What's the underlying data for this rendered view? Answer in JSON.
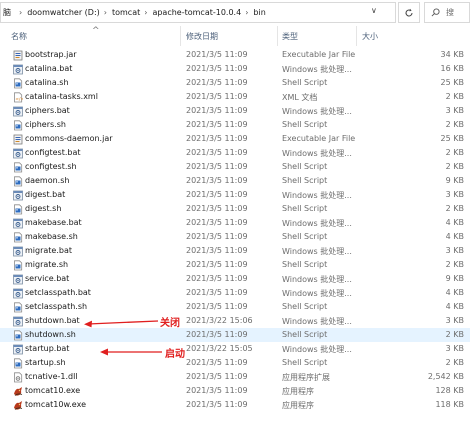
{
  "address": {
    "partial_crumb": "脑",
    "crumbs": [
      "doomwatcher (D:)",
      "tomcat",
      "apache-tomcat-10.0.4",
      "bin"
    ],
    "search_placeholder": "搜"
  },
  "columns": {
    "name": "名称",
    "date": "修改日期",
    "type": "类型",
    "size": "大小"
  },
  "files": [
    {
      "name": "bootstrap.jar",
      "date": "2021/3/5 11:09",
      "type": "Executable Jar File",
      "size": "34 KB",
      "icon": "jar-icon"
    },
    {
      "name": "catalina.bat",
      "date": "2021/3/5 11:09",
      "type": "Windows 批处理...",
      "size": "16 KB",
      "icon": "bat-icon"
    },
    {
      "name": "catalina.sh",
      "date": "2021/3/5 11:09",
      "type": "Shell Script",
      "size": "25 KB",
      "icon": "sh-icon"
    },
    {
      "name": "catalina-tasks.xml",
      "date": "2021/3/5 11:09",
      "type": "XML 文档",
      "size": "2 KB",
      "icon": "xml-icon"
    },
    {
      "name": "ciphers.bat",
      "date": "2021/3/5 11:09",
      "type": "Windows 批处理...",
      "size": "3 KB",
      "icon": "bat-icon"
    },
    {
      "name": "ciphers.sh",
      "date": "2021/3/5 11:09",
      "type": "Shell Script",
      "size": "2 KB",
      "icon": "sh-icon"
    },
    {
      "name": "commons-daemon.jar",
      "date": "2021/3/5 11:09",
      "type": "Executable Jar File",
      "size": "25 KB",
      "icon": "jar-icon"
    },
    {
      "name": "configtest.bat",
      "date": "2021/3/5 11:09",
      "type": "Windows 批处理...",
      "size": "2 KB",
      "icon": "bat-icon"
    },
    {
      "name": "configtest.sh",
      "date": "2021/3/5 11:09",
      "type": "Shell Script",
      "size": "2 KB",
      "icon": "sh-icon"
    },
    {
      "name": "daemon.sh",
      "date": "2021/3/5 11:09",
      "type": "Shell Script",
      "size": "9 KB",
      "icon": "sh-icon"
    },
    {
      "name": "digest.bat",
      "date": "2021/3/5 11:09",
      "type": "Windows 批处理...",
      "size": "3 KB",
      "icon": "bat-icon"
    },
    {
      "name": "digest.sh",
      "date": "2021/3/5 11:09",
      "type": "Shell Script",
      "size": "2 KB",
      "icon": "sh-icon"
    },
    {
      "name": "makebase.bat",
      "date": "2021/3/5 11:09",
      "type": "Windows 批处理...",
      "size": "4 KB",
      "icon": "bat-icon"
    },
    {
      "name": "makebase.sh",
      "date": "2021/3/5 11:09",
      "type": "Shell Script",
      "size": "4 KB",
      "icon": "sh-icon"
    },
    {
      "name": "migrate.bat",
      "date": "2021/3/5 11:09",
      "type": "Windows 批处理...",
      "size": "3 KB",
      "icon": "bat-icon"
    },
    {
      "name": "migrate.sh",
      "date": "2021/3/5 11:09",
      "type": "Shell Script",
      "size": "2 KB",
      "icon": "sh-icon"
    },
    {
      "name": "service.bat",
      "date": "2021/3/5 11:09",
      "type": "Windows 批处理...",
      "size": "9 KB",
      "icon": "bat-icon"
    },
    {
      "name": "setclasspath.bat",
      "date": "2021/3/5 11:09",
      "type": "Windows 批处理...",
      "size": "4 KB",
      "icon": "bat-icon"
    },
    {
      "name": "setclasspath.sh",
      "date": "2021/3/5 11:09",
      "type": "Shell Script",
      "size": "4 KB",
      "icon": "sh-icon"
    },
    {
      "name": "shutdown.bat",
      "date": "2021/3/22 15:06",
      "type": "Windows 批处理...",
      "size": "3 KB",
      "icon": "bat-icon"
    },
    {
      "name": "shutdown.sh",
      "date": "2021/3/5 11:09",
      "type": "Shell Script",
      "size": "2 KB",
      "icon": "sh-icon",
      "selected": true
    },
    {
      "name": "startup.bat",
      "date": "2021/3/22 15:05",
      "type": "Windows 批处理...",
      "size": "3 KB",
      "icon": "bat-icon"
    },
    {
      "name": "startup.sh",
      "date": "2021/3/5 11:09",
      "type": "Shell Script",
      "size": "2 KB",
      "icon": "sh-icon"
    },
    {
      "name": "tcnative-1.dll",
      "date": "2021/3/5 11:09",
      "type": "应用程序扩展",
      "size": "2,542 KB",
      "icon": "dll-icon"
    },
    {
      "name": "tomcat10.exe",
      "date": "2021/3/5 11:09",
      "type": "应用程序",
      "size": "128 KB",
      "icon": "tomcat-exe-icon"
    },
    {
      "name": "tomcat10w.exe",
      "date": "2021/3/5 11:09",
      "type": "应用程序",
      "size": "118 KB",
      "icon": "tomcat-exe-icon"
    }
  ],
  "annotations": {
    "shutdown_label": "关闭",
    "startup_label": "启动",
    "color": "#e01e1e"
  },
  "colors": {
    "selected_row": "#e5f3ff",
    "header_text": "#4c607a",
    "secondary_text": "#6d6d6d"
  }
}
